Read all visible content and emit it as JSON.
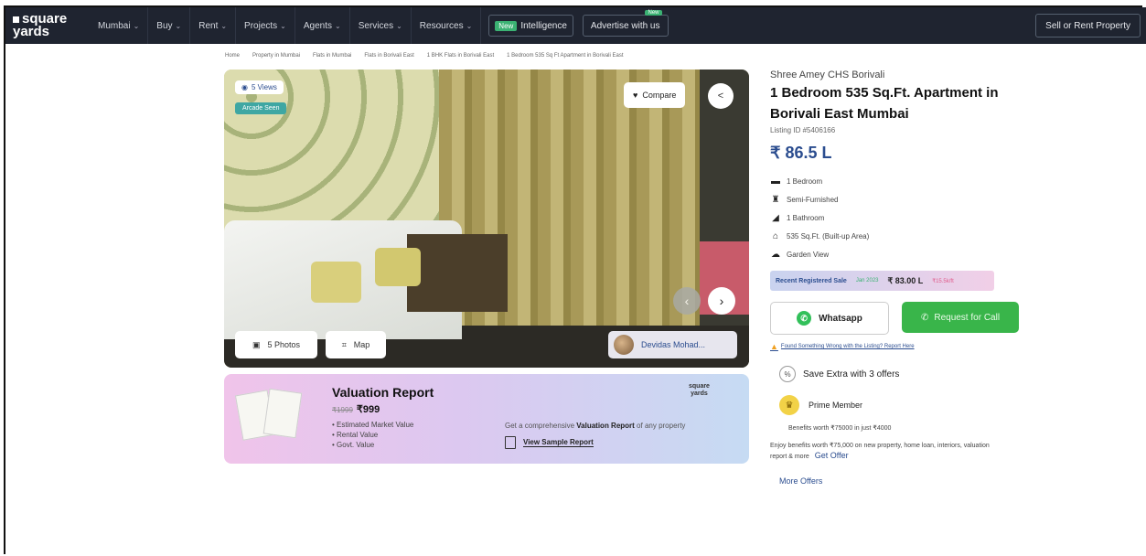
{
  "header": {
    "logo_line1": "square",
    "logo_line2": "yards",
    "nav": [
      "Mumbai",
      "Buy",
      "Rent",
      "Projects",
      "Agents",
      "Services",
      "Resources"
    ],
    "intelligence_tag": "New",
    "intelligence_label": "Intelligence",
    "advertise_label": "Advertise with us",
    "advertise_tag": "New",
    "sell_label": "Sell or Rent Property"
  },
  "breadcrumb": [
    "Home",
    "Property in Mumbai",
    "Flats in Mumbai",
    "Flats in Borivali East",
    "1 BHK Flats in Borivali East",
    "1 Bedroom 535 Sq Ft Apartment in Borivali East"
  ],
  "gallery": {
    "views": "5 Views",
    "arcade": "Arcade Seen",
    "compare": "Compare",
    "photos": "5 Photos",
    "map": "Map",
    "agent": "Devidas Mohad..."
  },
  "valuation": {
    "title": "Valuation Report",
    "old_price": "₹1999",
    "new_price": "₹999",
    "bullets": [
      "Estimated Market Value",
      "Rental Value",
      "Govt. Value"
    ],
    "desc_pre": "Get a comprehensive ",
    "desc_bold": "Valuation Report",
    "desc_post": " of any property",
    "sample_link": "View Sample Report",
    "brand_line1": "square",
    "brand_line2": "yards"
  },
  "listing": {
    "project": "Shree Amey CHS Borivali",
    "title": "1 Bedroom 535 Sq.Ft. Apartment in Borivali East Mumbai",
    "listing_id": "Listing ID #5406166",
    "price": "₹ 86.5 L",
    "features": [
      {
        "icon": "bed-icon",
        "glyph": "▬",
        "label": "1 Bedroom"
      },
      {
        "icon": "sofa-icon",
        "glyph": "♜",
        "label": "Semi-Furnished"
      },
      {
        "icon": "bath-icon",
        "glyph": "◢",
        "label": "1 Bathroom"
      },
      {
        "icon": "area-icon",
        "glyph": "⌂",
        "label": "535 Sq.Ft. (Built-up Area)"
      },
      {
        "icon": "garden-icon",
        "glyph": "☁",
        "label": "Garden View"
      }
    ],
    "recent_sale_label": "Recent Registered Sale",
    "recent_sale_date": "Jan 2023",
    "recent_sale_value": "₹ 83.00 L",
    "recent_sale_rate": "₹15.5k/ft",
    "whatsapp": "Whatsapp",
    "request_call": "Request for Call",
    "wrong_text": "Found Something Wrong with the Listing? Report Here",
    "save_extra": "Save Extra with 3 offers",
    "prime": "Prime Member",
    "benefits": "Benefits worth ₹75000 in just ₹4000",
    "enjoy": "Enjoy benefits worth ₹75,000 on new property, home loan, interiors, valuation report & more",
    "get_offer": "Get Offer",
    "more_offers": "More Offers"
  }
}
